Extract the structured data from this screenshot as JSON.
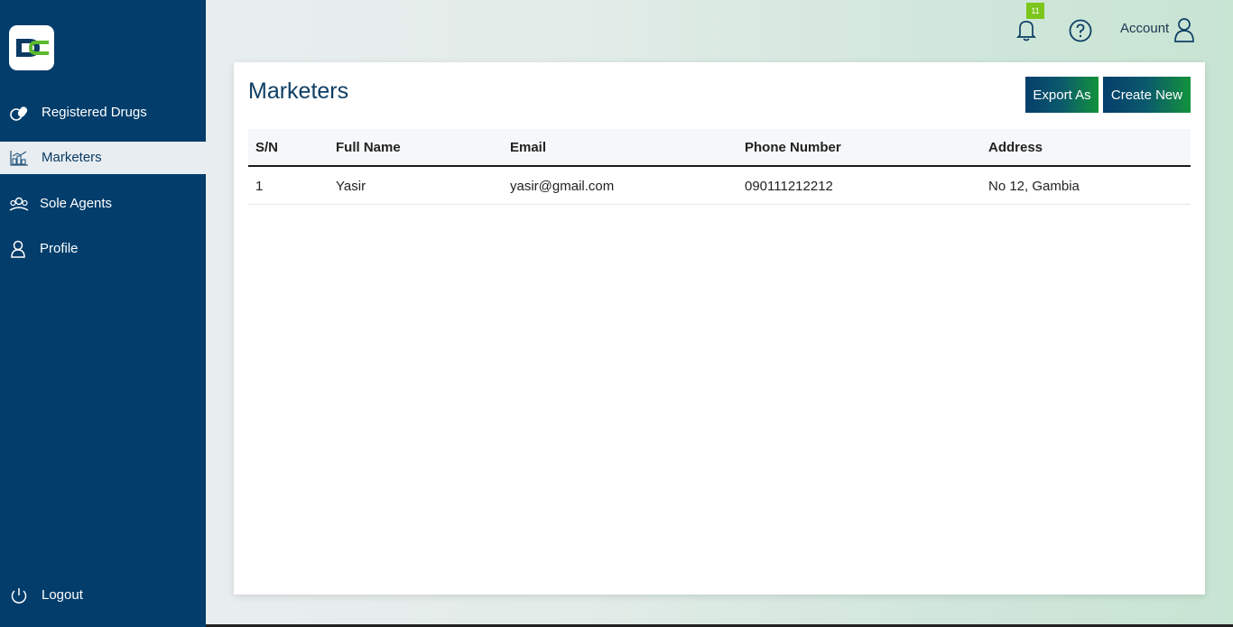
{
  "sidebar": {
    "logo_icon": "dc-logo",
    "items": [
      {
        "label": "Registered Drugs",
        "icon": "pills-icon"
      },
      {
        "label": "Marketers",
        "icon": "marketers-icon",
        "active": true
      },
      {
        "label": "Sole Agents",
        "icon": "agents-icon"
      },
      {
        "label": "Profile",
        "icon": "user-icon"
      }
    ],
    "logout": {
      "label": "Logout",
      "icon": "power-icon"
    }
  },
  "topbar": {
    "notification_count": "11",
    "account_label": "Account"
  },
  "main": {
    "title": "Marketers",
    "export_label": "Export As",
    "create_label": "Create New",
    "table": {
      "headers": [
        "S/N",
        "Full Name",
        "Email",
        "Phone Number",
        "Address"
      ],
      "rows": [
        [
          "1",
          "Yasir",
          "yasir@gmail.com",
          "090111212212",
          "No 12, Gambia"
        ]
      ]
    }
  },
  "colors": {
    "sidebar": "#023d6b",
    "accent_green": "#13923c",
    "badge": "#7cc51a"
  }
}
